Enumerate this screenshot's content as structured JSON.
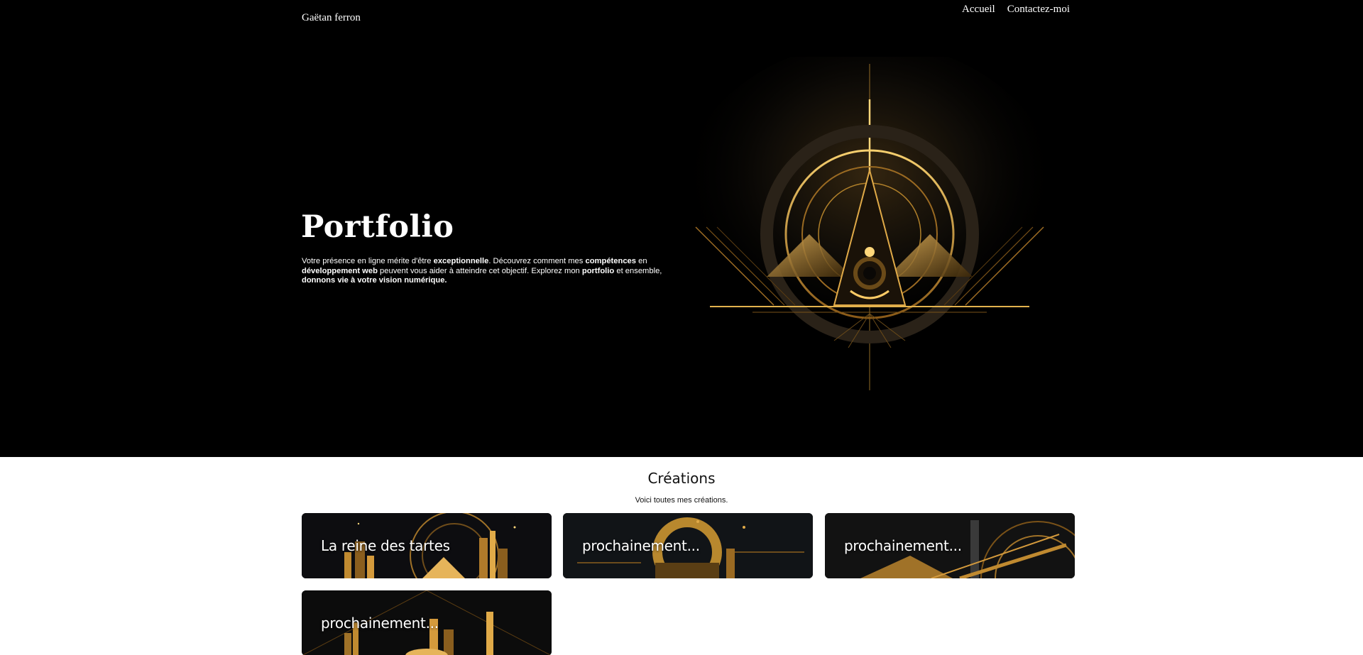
{
  "header": {
    "brand": "Gaëtan ferron",
    "nav": [
      {
        "label": "Accueil"
      },
      {
        "label": "Contactez-moi"
      }
    ]
  },
  "hero": {
    "title": "Portfolio",
    "desc_1": "Votre présence en ligne mérite d'être ",
    "desc_2": "exceptionnelle",
    "desc_3": ". Découvrez comment mes ",
    "desc_4": "compétences",
    "desc_5": " en ",
    "desc_6": "développement web",
    "desc_7": " peuvent vous aider à atteindre cet objectif. Explorez mon ",
    "desc_8": "portfolio",
    "desc_9": " et ensemble, ",
    "desc_10": "donnons vie à votre vision numérique.",
    "colors": {
      "background": "#000000",
      "gold": "#d9a23a"
    }
  },
  "creations": {
    "title": "Créations",
    "subtitle": "Voici toutes mes créations.",
    "cards": [
      {
        "label": "La reine des tartes"
      },
      {
        "label": "prochainement..."
      },
      {
        "label": "prochainement..."
      },
      {
        "label": "prochainement..."
      }
    ]
  }
}
